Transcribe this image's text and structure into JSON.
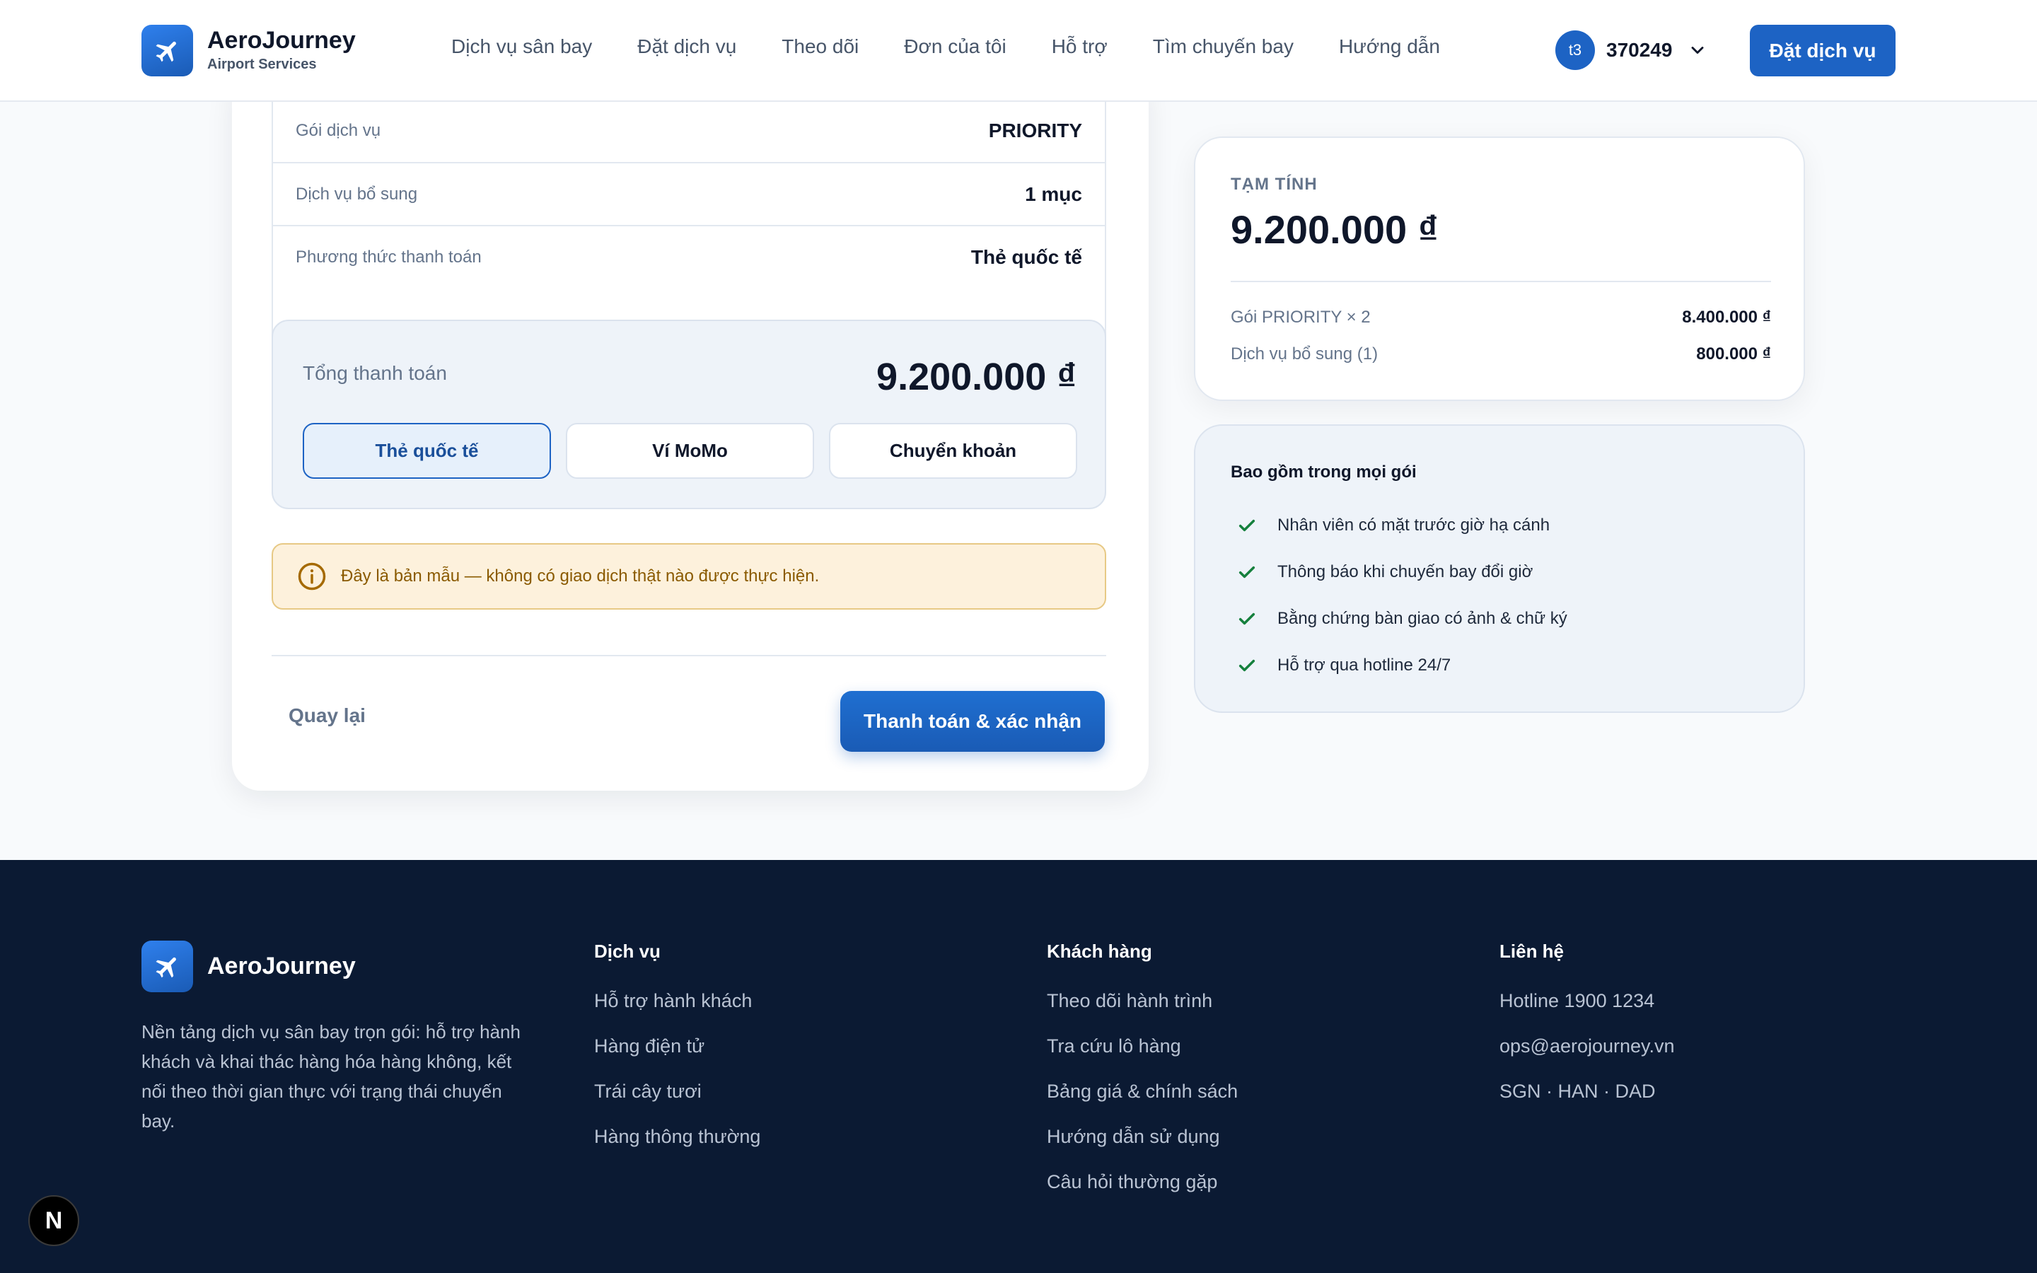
{
  "header": {
    "brand_name": "AeroJourney",
    "brand_sub": "Airport Services",
    "nav": [
      "Dịch vụ sân bay",
      "Đặt dịch vụ",
      "Theo dõi",
      "Đơn của tôi",
      "Hỗ trợ",
      "Tìm chuyến bay",
      "Hướng dẫn"
    ],
    "user_avatar": "t3",
    "user_id": "370249",
    "cta_label": "Đặt dịch vụ"
  },
  "summary": {
    "rows": [
      {
        "label": "Gói dịch vụ",
        "value": "PRIORITY"
      },
      {
        "label": "Dịch vụ bổ sung",
        "value": "1 mục"
      },
      {
        "label": "Phương thức thanh toán",
        "value": "Thẻ quốc tế"
      }
    ]
  },
  "payment": {
    "total_label": "Tổng thanh toán",
    "total_value": "9.200.000 ₫",
    "options": [
      "Thẻ quốc tế",
      "Ví MoMo",
      "Chuyển khoản"
    ],
    "selected": "Thẻ quốc tế"
  },
  "notice": {
    "text": "Đây là bản mẫu — không có giao dịch thật nào được thực hiện."
  },
  "actions": {
    "back_label": "Quay lại",
    "submit_label": "Thanh toán & xác nhận"
  },
  "estimate": {
    "title": "TẠM TÍNH",
    "amount": "9.200.000 ₫",
    "lines": [
      {
        "label": "Gói PRIORITY × 2",
        "value": "8.400.000 ₫"
      },
      {
        "label": "Dịch vụ bổ sung (1)",
        "value": "800.000 ₫"
      }
    ]
  },
  "includes": {
    "title": "Bao gồm trong mọi gói",
    "items": [
      "Nhân viên có mặt trước giờ hạ cánh",
      "Thông báo khi chuyến bay đổi giờ",
      "Bằng chứng bàn giao có ảnh & chữ ký",
      "Hỗ trợ qua hotline 24/7"
    ]
  },
  "footer": {
    "brand_name": "AeroJourney",
    "description": "Nền tảng dịch vụ sân bay trọn gói: hỗ trợ hành khách và khai thác hàng hóa hàng không, kết nối theo thời gian thực với trạng thái chuyến bay.",
    "columns": [
      {
        "title": "Dịch vụ",
        "links": [
          "Hỗ trợ hành khách",
          "Hàng điện tử",
          "Trái cây tươi",
          "Hàng thông thường"
        ]
      },
      {
        "title": "Khách hàng",
        "links": [
          "Theo dõi hành trình",
          "Tra cứu lô hàng",
          "Bảng giá & chính sách",
          "Hướng dẫn sử dụng",
          "Câu hỏi thường gặp"
        ]
      },
      {
        "title": "Liên hệ",
        "links": [
          "Hotline 1900 1234",
          "ops@aerojourney.vn",
          "SGN · HAN · DAD"
        ]
      }
    ]
  },
  "dev_badge": "N",
  "colors": {
    "primary": "#1d63c4",
    "footer_bg": "#0b1a33",
    "notice_bg": "#fdf1dc",
    "notice_text": "#8a5a00",
    "check": "#15803d"
  },
  "icons": {
    "logo": "airplane-icon",
    "user_menu": "chevron-down-icon",
    "notice": "info-icon",
    "include_item": "check-icon",
    "dev_badge": "nextjs-icon"
  }
}
